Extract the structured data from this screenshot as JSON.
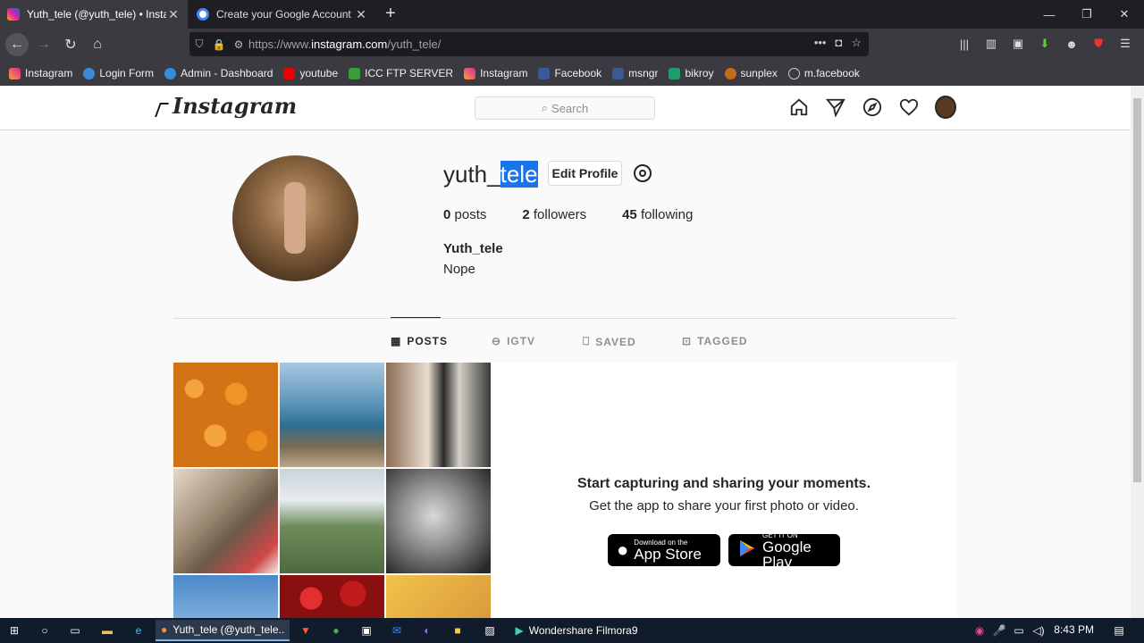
{
  "browser": {
    "tabs": [
      {
        "title": "Yuth_tele (@yuth_tele) • Instagram",
        "active": true
      },
      {
        "title": "Create your Google Account",
        "active": false
      }
    ],
    "url_prefix": "https://www.",
    "url_host": "instagram.com",
    "url_path": "/yuth_tele/",
    "bookmarks": [
      "Instagram",
      "Login Form",
      "Admin - Dashboard",
      "youtube",
      "ICC FTP SERVER",
      "Instagram",
      "Facebook",
      "msngr",
      "bikroy",
      "sunplex",
      "m.facebook"
    ]
  },
  "instagram": {
    "logo": "Instagram",
    "search_placeholder": "Search",
    "profile": {
      "username_prefix": "yuth_",
      "username_selected": "tele",
      "edit_label": "Edit Profile",
      "posts_count": "0",
      "posts_label": "posts",
      "followers_count": "2",
      "followers_label": "followers",
      "following_count": "45",
      "following_label": "following",
      "full_name": "Yuth_tele",
      "bio": "Nope"
    },
    "tabs": [
      "POSTS",
      "IGTV",
      "SAVED",
      "TAGGED"
    ],
    "empty": {
      "title": "Start capturing and sharing your moments.",
      "subtitle": "Get the app to share your first photo or video.",
      "appstore_small": "Download on the",
      "appstore_big": "App Store",
      "play_small": "GET IT ON",
      "play_big": "Google Play"
    }
  },
  "taskbar": {
    "firefox_label": "Yuth_tele (@yuth_tele...",
    "filmora_label": "Wondershare Filmora9",
    "time": "8:43 PM"
  }
}
